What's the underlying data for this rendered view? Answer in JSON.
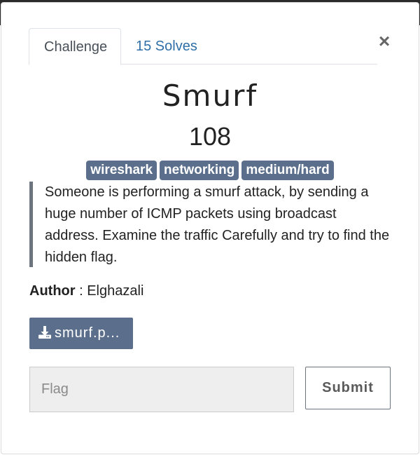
{
  "tabs": {
    "challenge_label": "Challenge",
    "solves_label": "15 Solves"
  },
  "close_symbol": "×",
  "challenge": {
    "name": "Smurf",
    "value": "108",
    "tags": [
      "wireshark",
      "networking",
      "medium/hard"
    ],
    "description": "Someone is performing a smurf attack, by sending a huge number of ICMP packets using broadcast address. Examine the traffic Carefully and try to find the hidden flag.",
    "author_label": "Author",
    "author_separator": " : ",
    "author_name": "Elghazali",
    "file_label": "smurf.p..."
  },
  "form": {
    "flag_placeholder": "Flag",
    "flag_value": "",
    "submit_label": "Submit"
  },
  "colors": {
    "tag_bg": "#5b6f8c",
    "link": "#2f6fa7",
    "download_bg": "#5b6f8c"
  },
  "icons": {
    "close": "close-icon",
    "download": "download-icon"
  }
}
